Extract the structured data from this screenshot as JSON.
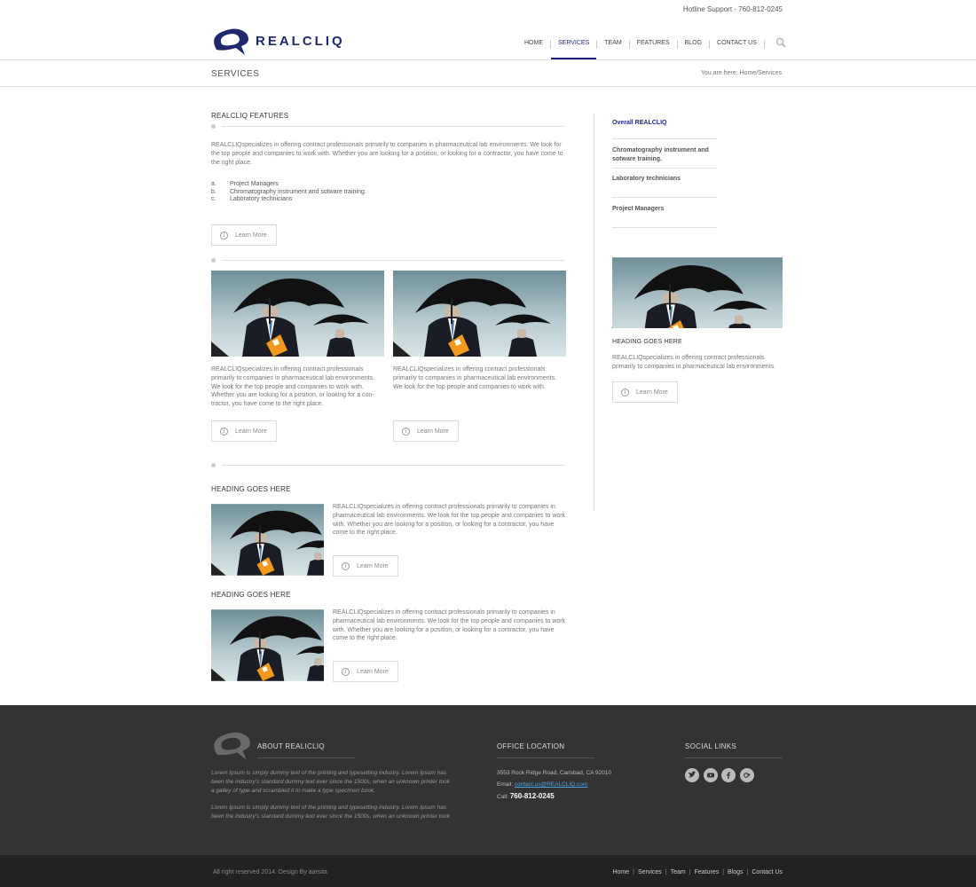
{
  "header": {
    "hotline": "Hotline Support - 760-812-0245",
    "logo_text": "REALCLIQ",
    "nav": [
      "HOME",
      "SERVICES",
      "TEAM",
      "FEATURES",
      "BLOG",
      "CONTACT US"
    ],
    "active_nav": "SERVICES",
    "search_icon": "search-icon",
    "page_title": "SERVICES",
    "breadcrumb": "You are here: Home/Services"
  },
  "main": {
    "features_title": "REALCLIQ FEATURES",
    "intro": "REALCLIQspecializes in offering contract professionals primarily to companies in pharmaceutical lab environments.  We look for the top people and companies to work with.  Whether you are looking for a position, or looking for a contractor, you have come to the right place.",
    "list": [
      {
        "marker": "a.",
        "text": "Project Managers"
      },
      {
        "marker": "b.",
        "text": "Chromatography instrument and sotware training."
      },
      {
        "marker": "c.",
        "text": "Laboratory technicians"
      }
    ],
    "learn_more": "Learn More",
    "card1": "REALCLIQspecializes in offering contract professionals primarily to companies in pharmaceutical lab environments. We look for the top people and companies to work with. Whether you are looking for a position, or looking for a con-tractor, you have come to the right place.",
    "card2": "REALCLIQspecializes in offering contract professionals primarily to companies in pharmaceutical lab environments. We look for the top people and companies to work with.",
    "heading1": "HEADING GOES HERE",
    "row_text": "REALCLIQspecializes in offering contract professionals primarily to companies in pharmaceutical lab environments.  We look for the top people and companies to work with.  Whether you are looking for a position, or looking for a contractor, you have come to the right place.",
    "heading2": "HEADING GOES HERE"
  },
  "sidebar": {
    "items": [
      "Overall REALCLIQ",
      "Chromatography instrument and sotware training.",
      "Laboratory technicians",
      "Project Managers"
    ],
    "heading": "HEADING GOES HERE",
    "text": "REALCLIQspecializes in offering contract professionals primarily to companies in pharmaceutical lab environments."
  },
  "footer": {
    "about_title": "ABOUT REALICLIQ",
    "about_text1": "Lorem Ipsum is simply dummy text of the printing and typesetting industry. Lorem Ipsum has been the industry's standard dummy text ever since the 1500s, when an unknown printer took a galley of type and scrambled it to make a type specimen book.",
    "about_text2": "Lorem Ipsum is simply dummy text of the printing and typesetting industry. Lorem Ipsum has been the industry's standard dummy text ever since the 1500s, when an unknown printer took",
    "office_title": "OFFICE LOCATION",
    "address": "3553 Rock Ridge Road, Carlsbad, CA  92010",
    "email_label": "Email:",
    "email": "contact.us@REALCLIQ.com",
    "call_label": "Call:",
    "phone": "760-812-0245",
    "social_title": "SOCIAL LINKS",
    "socials": [
      "twitter-icon",
      "youtube-icon",
      "facebook-icon",
      "google-plus-icon"
    ],
    "copyright": "All right reserved 2014. Design By aarsita",
    "bottom_nav": [
      "Home",
      "Services",
      "Team",
      "Features",
      "Blogs",
      "Contact Us"
    ]
  }
}
